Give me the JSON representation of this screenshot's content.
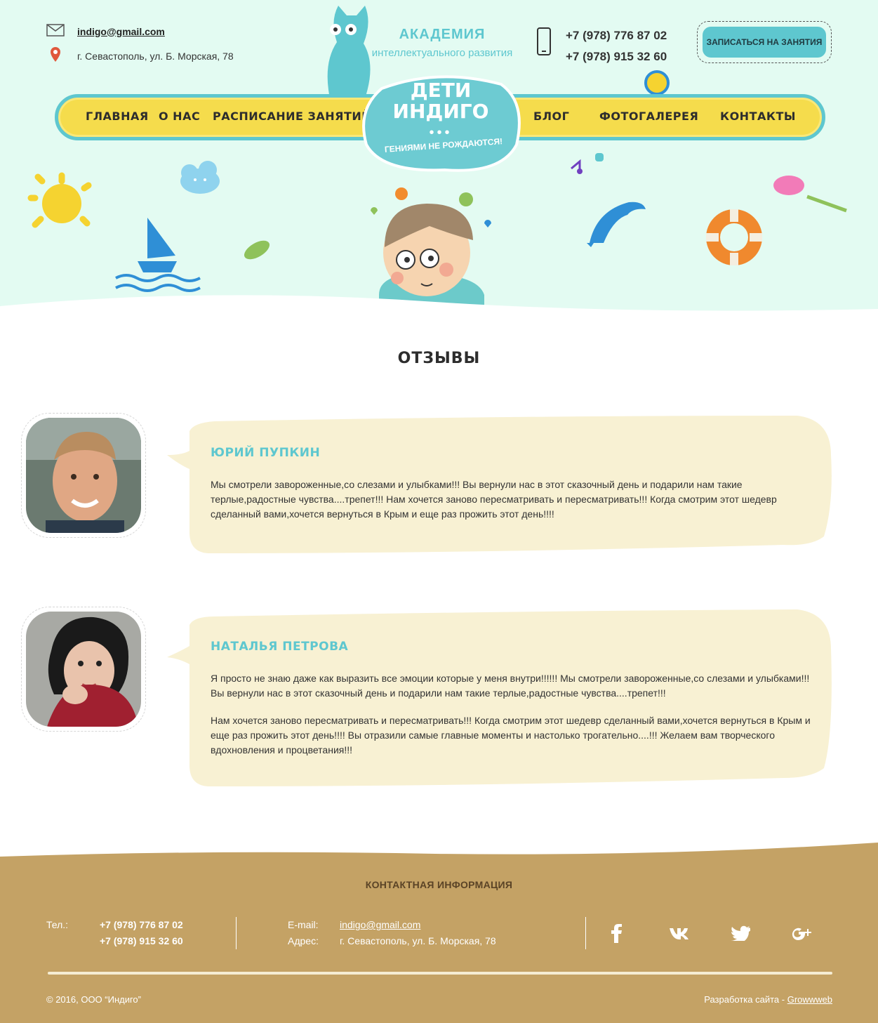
{
  "header": {
    "email": "indigo@gmail.com",
    "address": "г. Севастополь, ул. Б. Морская, 78",
    "brand_title": "АКАДЕМИЯ",
    "brand_subtitle": "интеллектуального развития",
    "phone_1": "+7 (978) 776 87 02",
    "phone_2": "+7 (978) 915 32 60",
    "cta_label": "ЗАПИСАТЬСЯ НА ЗАНЯТИЯ"
  },
  "logo": {
    "line1": "ДЕТИ",
    "line2": "ИНДИГО",
    "dots": "•••",
    "slogan": "ГЕНИЯМИ НЕ РОЖДАЮТСЯ!"
  },
  "nav": {
    "items": [
      {
        "label": "ГЛАВНАЯ"
      },
      {
        "label": "О НАС"
      },
      {
        "label": "РАСПИСАНИЕ ЗАНЯТИЙ"
      },
      {
        "label": "БЛОГ"
      },
      {
        "label": "ФОТОГАЛЕРЕЯ"
      },
      {
        "label": "КОНТАКТЫ"
      }
    ]
  },
  "page": {
    "title": "ОТЗЫВЫ"
  },
  "reviews": [
    {
      "name": "ЮРИЙ ПУПКИН",
      "paragraphs": [
        "Мы смотрели завороженные,со слезами и улыбками!!! Вы вернули нас в этот сказочный день и подарили нам такие терлые,радостные чувства....трепет!!! Нам хочется заново пересматривать и пересматривать!!! Когда смотрим этот шедевр сделанный вами,хочется вернуться в Крым и еще раз прожить этот день!!!!"
      ]
    },
    {
      "name": "НАТАЛЬЯ ПЕТРОВА",
      "paragraphs": [
        "Я просто не знаю даже как выразить все эмоции которые у меня внутри!!!!!! Мы смотрели завороженные,со слезами и улыбками!!! Вы вернули нас в этот сказочный день и подарили нам такие терлые,радостные чувства....трепет!!!",
        "Нам хочется заново пересматривать и пересматривать!!! Когда смотрим этот шедевр сделанный вами,хочется вернуться в Крым и еще раз прожить этот день!!!! Вы отразили самые главные моменты и настолько трогательно....!!! Желаем вам творческого вдохновления и процветания!!!"
      ]
    }
  ],
  "footer": {
    "title": "КОНТАКТНАЯ ИНФОРМАЦИЯ",
    "phone_label": "Тел.:",
    "phone_1": "+7 (978) 776 87 02",
    "phone_2": "+7 (978) 915 32 60",
    "email_label": "E-mail:",
    "email": "indigo@gmail.com",
    "address_label": "Адрес:",
    "address": "г. Севастополь, ул. Б. Морская, 78",
    "social": [
      "facebook-icon",
      "vk-icon",
      "twitter-icon",
      "google-plus-icon"
    ],
    "copyright": "© 2016, ООО “Индиго”",
    "dev_prefix": "Разработка сайта - ",
    "dev_link": "Growwweb"
  },
  "colors": {
    "header_bg": "#e3fbf2",
    "accent": "#5ec7cf",
    "nav_yellow": "#f5dc4c",
    "bubble": "#f8f1d3",
    "footer_bg": "#c4a265"
  }
}
